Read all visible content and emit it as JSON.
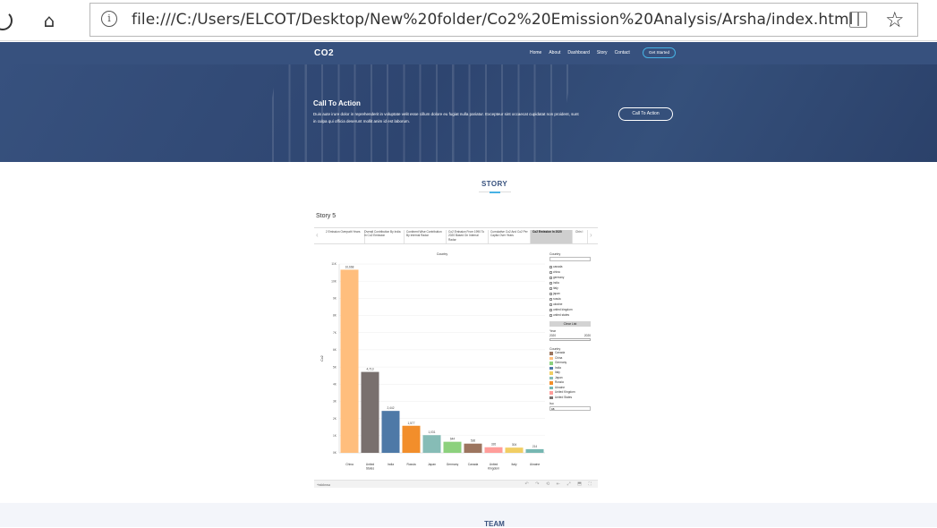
{
  "browser": {
    "url": "file:///C:/Users/ELCOT/Desktop/New%20folder/Co2%20Emission%20Analysis/Arsha/index.html",
    "home_icon": "⌂",
    "info_icon": "i",
    "star_icon": "☆"
  },
  "header": {
    "logo": "CO2",
    "nav": [
      "Home",
      "About",
      "Dashboard",
      "Story",
      "Contact"
    ],
    "cta_button": "Get Started"
  },
  "cta": {
    "title": "Call To Action",
    "text": "Duis aute irure dolor in reprehenderit in voluptate velit esse cillum dolore eu fugiat nulla pariatur. Excepteur sint occaecat cupidatat non proident, sunt in culpa qui officia deserunt mollit anim id est laborum.",
    "button": "Call To Action"
  },
  "story_section": {
    "title": "STORY"
  },
  "tableau": {
    "story_label": "Story 5",
    "tabs": [
      {
        "label": "2 Emission Overpath Years",
        "active": false
      },
      {
        "label": "Overall Contribution By India In Co2 Emission",
        "active": false
      },
      {
        "label": "Continent Wise Contribution By Internal Radar",
        "active": false
      },
      {
        "label": "Co2 Emission From 1990 To 2020 Based On Internal Radar",
        "active": false
      },
      {
        "label": "Cumulative Co2 And Co2 Per Capita Over Years",
        "active": false
      },
      {
        "label": "Co2 Emission In 2020",
        "active": true
      },
      {
        "label": "Chin I",
        "active": false
      }
    ],
    "side": {
      "country_filter_heading": "Country",
      "countries": [
        "canada",
        "china",
        "germany",
        "india",
        "italy",
        "japan",
        "russia",
        "ukraine",
        "united kingdom",
        "united states"
      ],
      "clear_list": "Clear List",
      "year_heading": "Year",
      "year_min": "2020",
      "year_max": "2020",
      "legend_heading": "Country",
      "legend": [
        {
          "name": "Canada",
          "color": "#9c755f"
        },
        {
          "name": "China",
          "color": "#ffbe7d"
        },
        {
          "name": "Germany",
          "color": "#8cd17d"
        },
        {
          "name": "India",
          "color": "#4e79a7"
        },
        {
          "name": "Italy",
          "color": "#f1ce63"
        },
        {
          "name": "Japan",
          "color": "#86bcb6"
        },
        {
          "name": "Russia",
          "color": "#f28e2b"
        },
        {
          "name": "Ukraine",
          "color": "#76b7b2"
        },
        {
          "name": "United Kingdom",
          "color": "#ff9d9a"
        },
        {
          "name": "United States",
          "color": "#79706e"
        }
      ],
      "bottom_heading": "Iso",
      "bottom_value": "ca"
    },
    "footer_logo": "+ableau",
    "footer_icons": "↶ ↷ ⟲ ⇤ ⤢ ⬒ ⛶"
  },
  "chart_data": {
    "type": "bar",
    "title": "Country",
    "xlabel": "",
    "ylabel": "Co2",
    "ylim": [
      0,
      11000
    ],
    "yticks": [
      "0K",
      "1K",
      "2K",
      "3K",
      "4K",
      "5K",
      "6K",
      "7K",
      "8K",
      "9K",
      "10K",
      "11K"
    ],
    "categories": [
      "China",
      "United States",
      "India",
      "Russia",
      "Japan",
      "Germany",
      "Canada",
      "United Kingdom",
      "Italy",
      "Ukraine"
    ],
    "values": [
      10668,
      4713,
      2442,
      1577,
      1031,
      644,
      536,
      326,
      304,
      214
    ],
    "colors": [
      "#ffbe7d",
      "#79706e",
      "#4e79a7",
      "#f28e2b",
      "#86bcb6",
      "#8cd17d",
      "#9c755f",
      "#ff9d9a",
      "#f1ce63",
      "#76b7b2"
    ],
    "value_labels": [
      "10,668",
      "4,713",
      "2,442",
      "1,577",
      "1,031",
      "644",
      "536",
      "326",
      "304",
      "214"
    ]
  },
  "team_section": {
    "title": "TEAM"
  }
}
